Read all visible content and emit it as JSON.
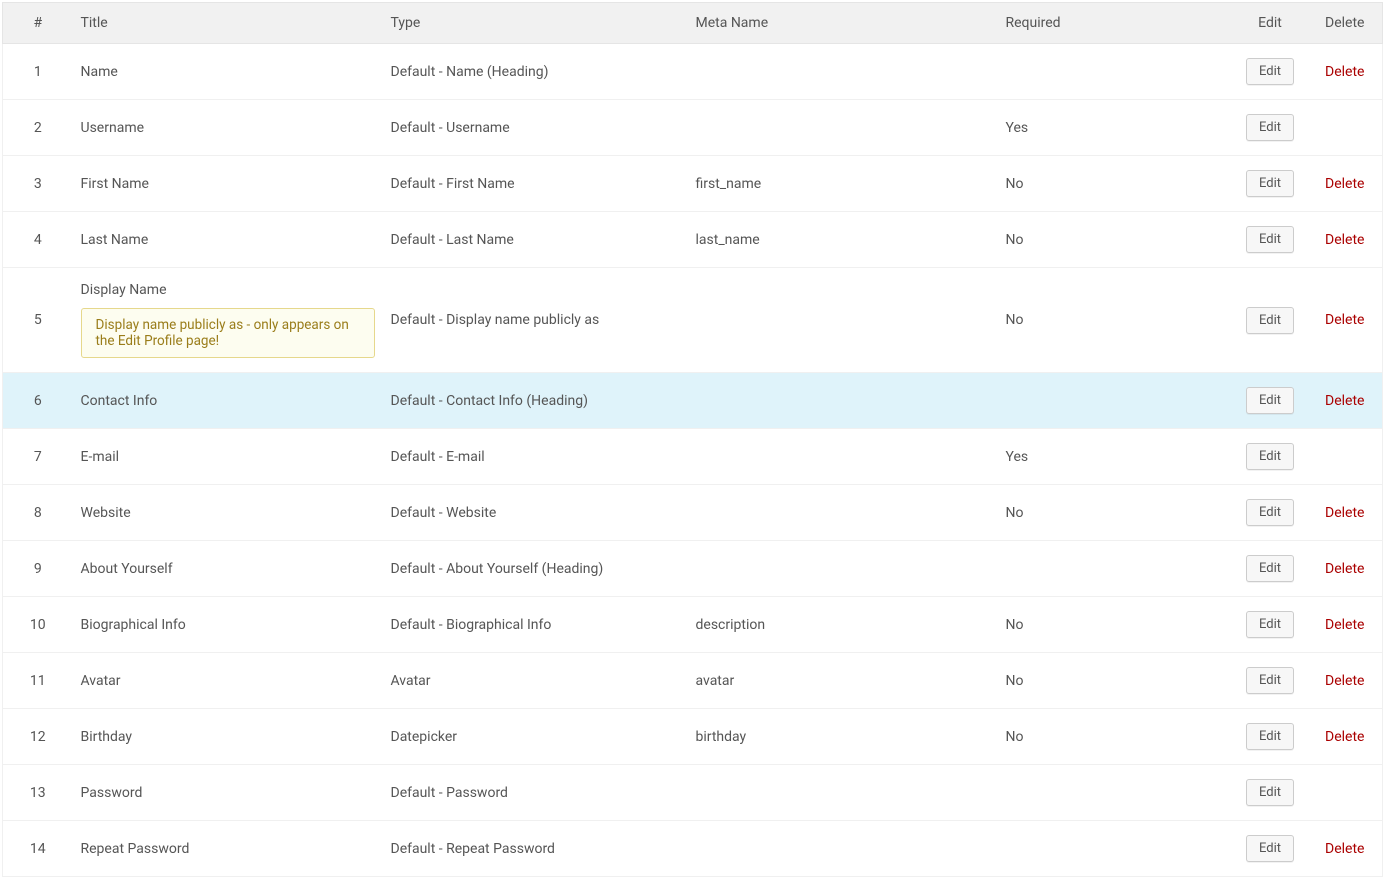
{
  "headers": {
    "num": "#",
    "title": "Title",
    "type": "Type",
    "meta": "Meta Name",
    "required": "Required",
    "edit": "Edit",
    "delete": "Delete"
  },
  "labels": {
    "edit_btn": "Edit",
    "delete_link": "Delete"
  },
  "rows": [
    {
      "num": "1",
      "title": "Name",
      "type": "Default - Name (Heading)",
      "meta": "",
      "required": "",
      "edit": true,
      "delete": true,
      "note": ""
    },
    {
      "num": "2",
      "title": "Username",
      "type": "Default - Username",
      "meta": "",
      "required": "Yes",
      "edit": true,
      "delete": false,
      "note": ""
    },
    {
      "num": "3",
      "title": "First Name",
      "type": "Default - First Name",
      "meta": "first_name",
      "required": "No",
      "edit": true,
      "delete": true,
      "note": ""
    },
    {
      "num": "4",
      "title": "Last Name",
      "type": "Default - Last Name",
      "meta": "last_name",
      "required": "No",
      "edit": true,
      "delete": true,
      "note": ""
    },
    {
      "num": "5",
      "title": "Display Name",
      "type": "Default - Display name publicly as",
      "meta": "",
      "required": "No",
      "edit": true,
      "delete": true,
      "note": "Display name publicly as - only appears on the Edit Profile page!"
    },
    {
      "num": "6",
      "title": "Contact Info",
      "type": "Default - Contact Info (Heading)",
      "meta": "",
      "required": "",
      "edit": true,
      "delete": true,
      "note": "",
      "highlight": true
    },
    {
      "num": "7",
      "title": "E-mail",
      "type": "Default - E-mail",
      "meta": "",
      "required": "Yes",
      "edit": true,
      "delete": false,
      "note": ""
    },
    {
      "num": "8",
      "title": "Website",
      "type": "Default - Website",
      "meta": "",
      "required": "No",
      "edit": true,
      "delete": true,
      "note": ""
    },
    {
      "num": "9",
      "title": "About Yourself",
      "type": "Default - About Yourself (Heading)",
      "meta": "",
      "required": "",
      "edit": true,
      "delete": true,
      "note": ""
    },
    {
      "num": "10",
      "title": "Biographical Info",
      "type": "Default - Biographical Info",
      "meta": "description",
      "required": "No",
      "edit": true,
      "delete": true,
      "note": ""
    },
    {
      "num": "11",
      "title": "Avatar",
      "type": "Avatar",
      "meta": "avatar",
      "required": "No",
      "edit": true,
      "delete": true,
      "note": ""
    },
    {
      "num": "12",
      "title": "Birthday",
      "type": "Datepicker",
      "meta": "birthday",
      "required": "No",
      "edit": true,
      "delete": true,
      "note": ""
    },
    {
      "num": "13",
      "title": "Password",
      "type": "Default - Password",
      "meta": "",
      "required": "",
      "edit": true,
      "delete": false,
      "note": ""
    },
    {
      "num": "14",
      "title": "Repeat Password",
      "type": "Default - Repeat Password",
      "meta": "",
      "required": "",
      "edit": true,
      "delete": true,
      "note": ""
    }
  ]
}
